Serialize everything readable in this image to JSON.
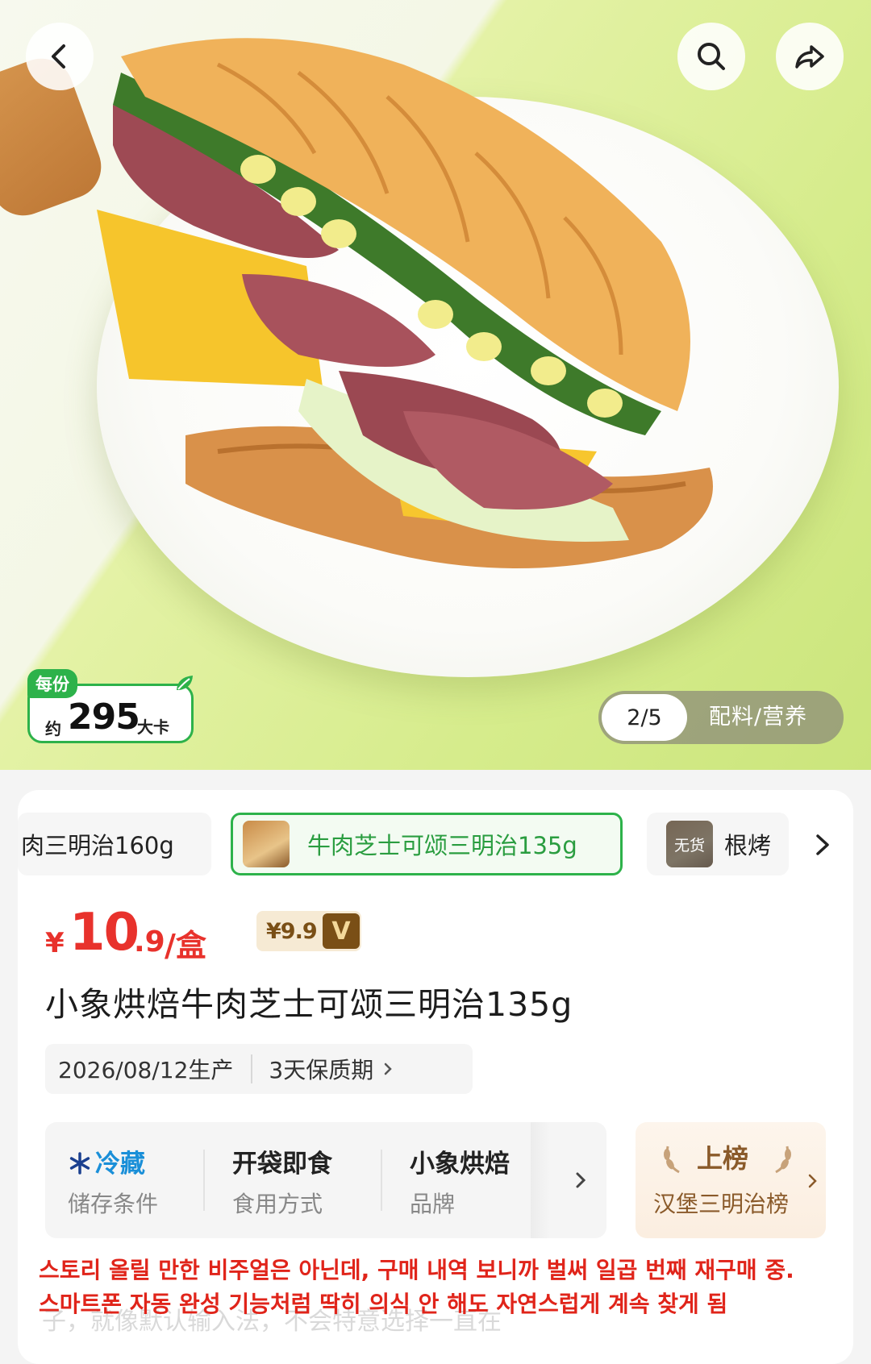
{
  "hero": {
    "calorie": {
      "tag": "每份",
      "approx": "约",
      "value": "295",
      "unit": "大卡"
    },
    "pager": {
      "current": "2/5",
      "label": "配料/营养"
    }
  },
  "variants": [
    {
      "label": "肉三明治160g",
      "stock_tag": ""
    },
    {
      "label": "牛肉芝士可颂三明治135g",
      "stock_tag": ""
    },
    {
      "label": "根烤",
      "stock_tag": "无货"
    }
  ],
  "price": {
    "currency": "¥",
    "integer": "10",
    "decimal": ".9",
    "per_unit": "/盒",
    "member_price": "¥9.9",
    "member_logo": "V"
  },
  "product_title": "小象烘焙牛肉芝士可颂三明治135g",
  "meta": {
    "production_date": "2026/08/12生产",
    "shelf_life": "3天保质期"
  },
  "attributes": [
    {
      "value": "冷藏",
      "key": "储存条件",
      "icon": "snowflake-icon"
    },
    {
      "value": "开袋即食",
      "key": "食用方式"
    },
    {
      "value": "小象烘焙",
      "key": "品牌"
    }
  ],
  "ranking": {
    "badge": "上榜",
    "name": "汉堡三明治榜"
  },
  "caption": {
    "ghost": "子，就像默认输入法，不会特意选择一直在",
    "line1": "스토리 올릴 만한 비주얼은 아닌데, 구매 내역 보니까 벌써 일곱 번째 재구매 중.",
    "line2": "스마트폰 자동 완성 기능처럼 딱히 의식 안 해도 자연스럽게 계속 찾게 됨"
  },
  "colors": {
    "accent_green": "#2db24a",
    "price_red": "#e8322c",
    "caption_red": "#e0241a",
    "vip_brown": "#7a4f16"
  }
}
